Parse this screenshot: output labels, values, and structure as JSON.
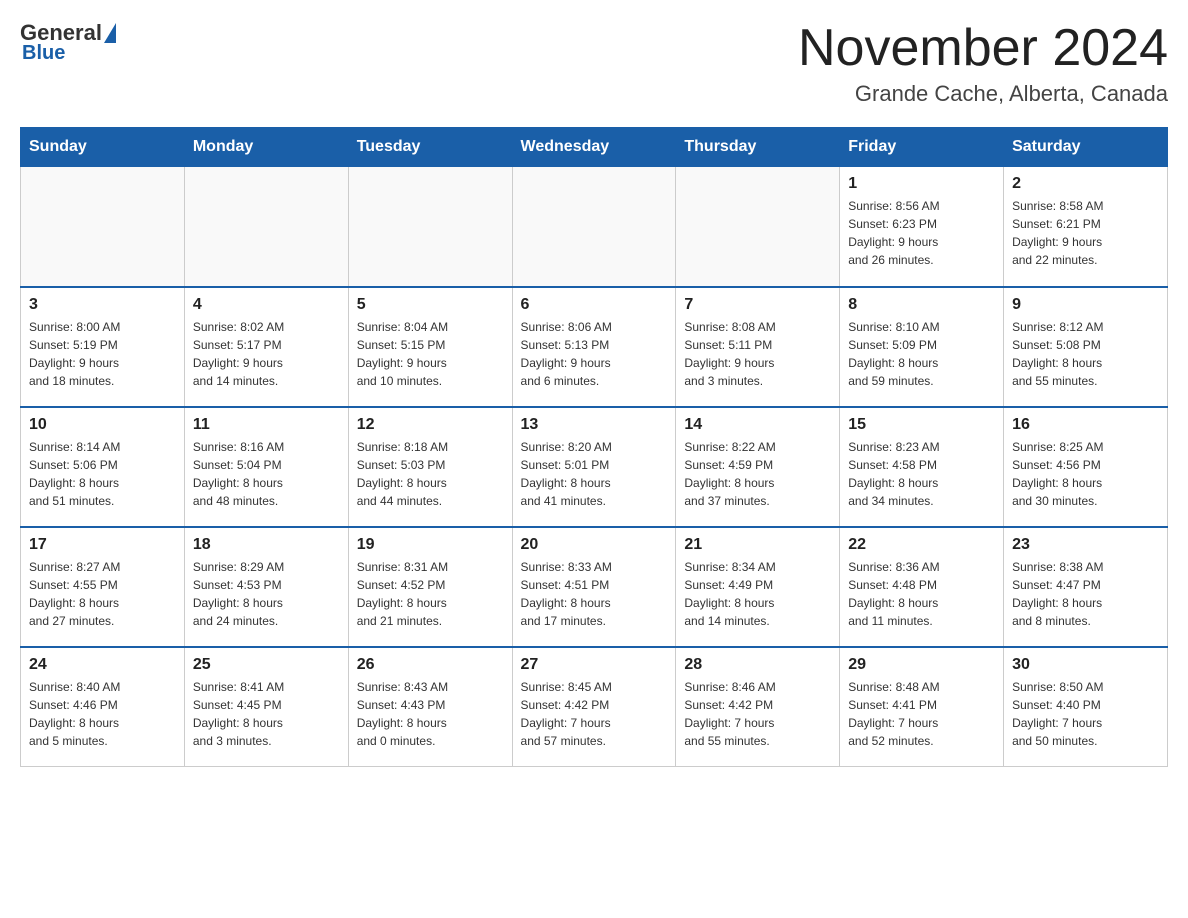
{
  "logo": {
    "general_text": "General",
    "blue_text": "Blue"
  },
  "title": "November 2024",
  "location": "Grande Cache, Alberta, Canada",
  "weekdays": [
    "Sunday",
    "Monday",
    "Tuesday",
    "Wednesday",
    "Thursday",
    "Friday",
    "Saturday"
  ],
  "weeks": [
    [
      {
        "day": "",
        "info": ""
      },
      {
        "day": "",
        "info": ""
      },
      {
        "day": "",
        "info": ""
      },
      {
        "day": "",
        "info": ""
      },
      {
        "day": "",
        "info": ""
      },
      {
        "day": "1",
        "info": "Sunrise: 8:56 AM\nSunset: 6:23 PM\nDaylight: 9 hours\nand 26 minutes."
      },
      {
        "day": "2",
        "info": "Sunrise: 8:58 AM\nSunset: 6:21 PM\nDaylight: 9 hours\nand 22 minutes."
      }
    ],
    [
      {
        "day": "3",
        "info": "Sunrise: 8:00 AM\nSunset: 5:19 PM\nDaylight: 9 hours\nand 18 minutes."
      },
      {
        "day": "4",
        "info": "Sunrise: 8:02 AM\nSunset: 5:17 PM\nDaylight: 9 hours\nand 14 minutes."
      },
      {
        "day": "5",
        "info": "Sunrise: 8:04 AM\nSunset: 5:15 PM\nDaylight: 9 hours\nand 10 minutes."
      },
      {
        "day": "6",
        "info": "Sunrise: 8:06 AM\nSunset: 5:13 PM\nDaylight: 9 hours\nand 6 minutes."
      },
      {
        "day": "7",
        "info": "Sunrise: 8:08 AM\nSunset: 5:11 PM\nDaylight: 9 hours\nand 3 minutes."
      },
      {
        "day": "8",
        "info": "Sunrise: 8:10 AM\nSunset: 5:09 PM\nDaylight: 8 hours\nand 59 minutes."
      },
      {
        "day": "9",
        "info": "Sunrise: 8:12 AM\nSunset: 5:08 PM\nDaylight: 8 hours\nand 55 minutes."
      }
    ],
    [
      {
        "day": "10",
        "info": "Sunrise: 8:14 AM\nSunset: 5:06 PM\nDaylight: 8 hours\nand 51 minutes."
      },
      {
        "day": "11",
        "info": "Sunrise: 8:16 AM\nSunset: 5:04 PM\nDaylight: 8 hours\nand 48 minutes."
      },
      {
        "day": "12",
        "info": "Sunrise: 8:18 AM\nSunset: 5:03 PM\nDaylight: 8 hours\nand 44 minutes."
      },
      {
        "day": "13",
        "info": "Sunrise: 8:20 AM\nSunset: 5:01 PM\nDaylight: 8 hours\nand 41 minutes."
      },
      {
        "day": "14",
        "info": "Sunrise: 8:22 AM\nSunset: 4:59 PM\nDaylight: 8 hours\nand 37 minutes."
      },
      {
        "day": "15",
        "info": "Sunrise: 8:23 AM\nSunset: 4:58 PM\nDaylight: 8 hours\nand 34 minutes."
      },
      {
        "day": "16",
        "info": "Sunrise: 8:25 AM\nSunset: 4:56 PM\nDaylight: 8 hours\nand 30 minutes."
      }
    ],
    [
      {
        "day": "17",
        "info": "Sunrise: 8:27 AM\nSunset: 4:55 PM\nDaylight: 8 hours\nand 27 minutes."
      },
      {
        "day": "18",
        "info": "Sunrise: 8:29 AM\nSunset: 4:53 PM\nDaylight: 8 hours\nand 24 minutes."
      },
      {
        "day": "19",
        "info": "Sunrise: 8:31 AM\nSunset: 4:52 PM\nDaylight: 8 hours\nand 21 minutes."
      },
      {
        "day": "20",
        "info": "Sunrise: 8:33 AM\nSunset: 4:51 PM\nDaylight: 8 hours\nand 17 minutes."
      },
      {
        "day": "21",
        "info": "Sunrise: 8:34 AM\nSunset: 4:49 PM\nDaylight: 8 hours\nand 14 minutes."
      },
      {
        "day": "22",
        "info": "Sunrise: 8:36 AM\nSunset: 4:48 PM\nDaylight: 8 hours\nand 11 minutes."
      },
      {
        "day": "23",
        "info": "Sunrise: 8:38 AM\nSunset: 4:47 PM\nDaylight: 8 hours\nand 8 minutes."
      }
    ],
    [
      {
        "day": "24",
        "info": "Sunrise: 8:40 AM\nSunset: 4:46 PM\nDaylight: 8 hours\nand 5 minutes."
      },
      {
        "day": "25",
        "info": "Sunrise: 8:41 AM\nSunset: 4:45 PM\nDaylight: 8 hours\nand 3 minutes."
      },
      {
        "day": "26",
        "info": "Sunrise: 8:43 AM\nSunset: 4:43 PM\nDaylight: 8 hours\nand 0 minutes."
      },
      {
        "day": "27",
        "info": "Sunrise: 8:45 AM\nSunset: 4:42 PM\nDaylight: 7 hours\nand 57 minutes."
      },
      {
        "day": "28",
        "info": "Sunrise: 8:46 AM\nSunset: 4:42 PM\nDaylight: 7 hours\nand 55 minutes."
      },
      {
        "day": "29",
        "info": "Sunrise: 8:48 AM\nSunset: 4:41 PM\nDaylight: 7 hours\nand 52 minutes."
      },
      {
        "day": "30",
        "info": "Sunrise: 8:50 AM\nSunset: 4:40 PM\nDaylight: 7 hours\nand 50 minutes."
      }
    ]
  ]
}
